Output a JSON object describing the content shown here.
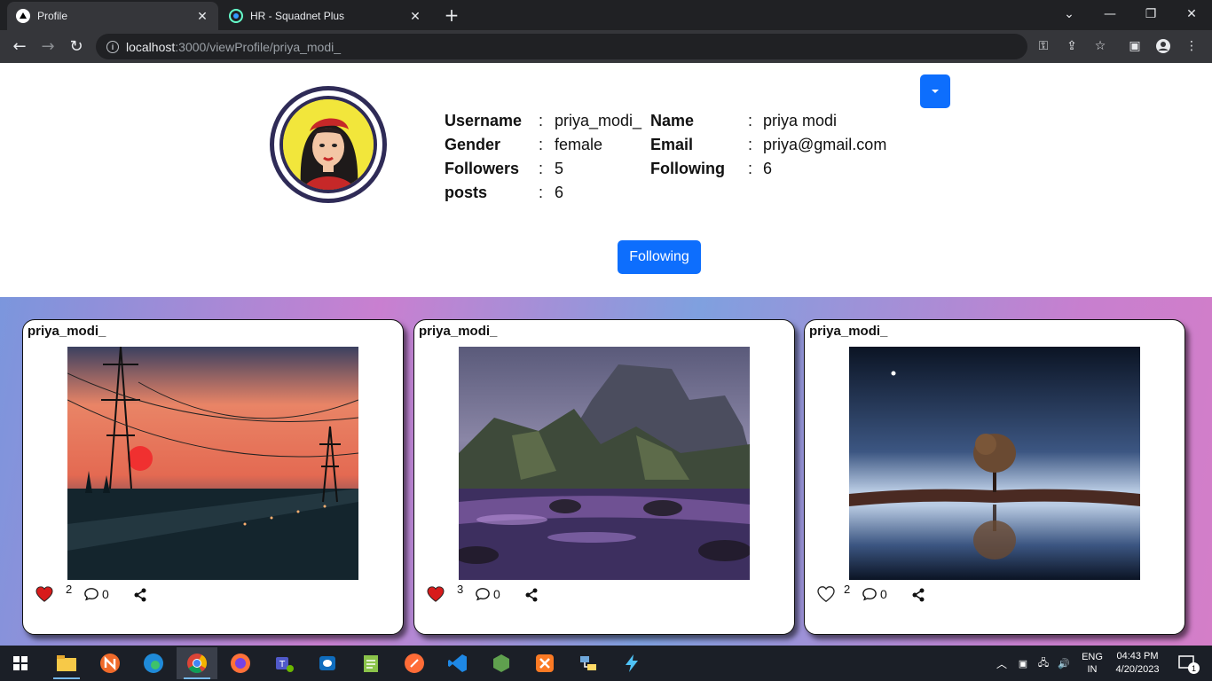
{
  "browser": {
    "tabs": [
      {
        "title": "Profile",
        "icon": "nextjs-triangle-icon"
      },
      {
        "title": "HR - Squadnet Plus",
        "icon": "squadnet-logo-icon"
      }
    ],
    "url_host": "localhost",
    "url_rest": ":3000/viewProfile/priya_modi_"
  },
  "profile": {
    "fields": [
      {
        "label": "Username",
        "value": "priya_modi_"
      },
      {
        "label": "Name",
        "value": "priya modi"
      },
      {
        "label": "Gender",
        "value": "female"
      },
      {
        "label": "Email",
        "value": "priya@gmail.com"
      },
      {
        "label": "Followers",
        "value": "5"
      },
      {
        "label": "Following",
        "value": "6"
      },
      {
        "label": "posts",
        "value": "6"
      }
    ],
    "separator": ":",
    "follow_button": "Following",
    "accent_color": "#0d6efd"
  },
  "posts": [
    {
      "user": "priya_modi_",
      "image": "sunset-power-lines",
      "likes": "2",
      "liked": true,
      "comments": "0"
    },
    {
      "user": "priya_modi_",
      "image": "purple-rocky-coast",
      "likes": "3",
      "liked": true,
      "comments": "0"
    },
    {
      "user": "priya_modi_",
      "image": "tree-reflection-night",
      "likes": "2",
      "liked": false,
      "comments": "0"
    }
  ],
  "taskbar": {
    "apps": [
      "file-explorer-icon",
      "app-n-icon",
      "edge-icon",
      "chrome-icon",
      "firefox-icon",
      "teams-icon",
      "outlook-icon",
      "notepadpp-icon",
      "postman-icon",
      "vscode-icon",
      "nodejs-icon",
      "xampp-icon",
      "network-app-icon",
      "bolt-app-icon"
    ],
    "language": "ENG",
    "region": "IN",
    "time": "04:43 PM",
    "date": "4/20/2023",
    "notifications": "1"
  }
}
